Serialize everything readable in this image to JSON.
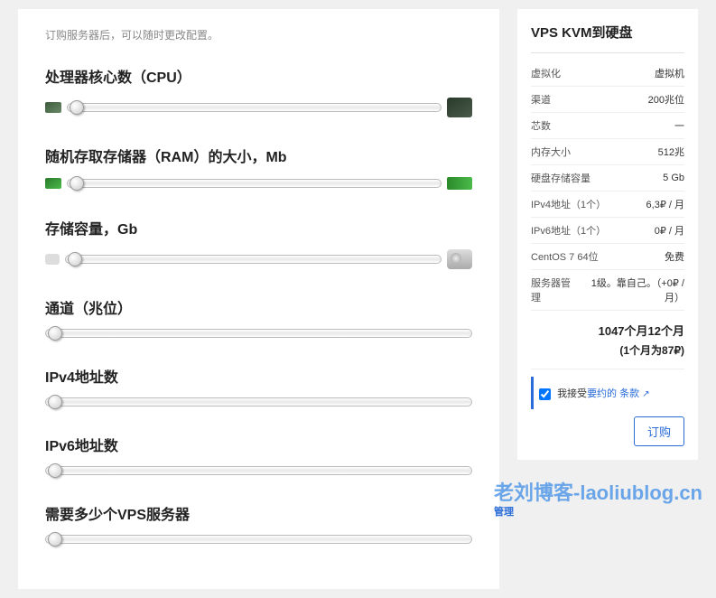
{
  "intro": "订购服务器后，可以随时更改配置。",
  "sliders": {
    "cpu": {
      "label": "处理器核心数（CPU）"
    },
    "ram": {
      "label": "随机存取存储器（RAM）的大小，Mb"
    },
    "storage": {
      "label": "存储容量，Gb"
    },
    "channel": {
      "label": "通道（兆位）"
    },
    "ipv4": {
      "label": "IPv4地址数"
    },
    "ipv6": {
      "label": "IPv6地址数"
    },
    "vpscount": {
      "label": "需要多少个VPS服务器"
    }
  },
  "summary": {
    "title": "VPS KVM到硬盘",
    "rows": [
      {
        "label": "虚拟化",
        "value": "虚拟机"
      },
      {
        "label": "渠道",
        "value": "200兆位"
      },
      {
        "label": "芯数",
        "value": "一"
      },
      {
        "label": "内存大小",
        "value": "512兆"
      },
      {
        "label": "硬盘存储容量",
        "value": "5 Gb"
      },
      {
        "label": "IPv4地址（1个）",
        "value": "6,3₽ / 月"
      },
      {
        "label": "IPv6地址（1个）",
        "value": "0₽ / 月"
      },
      {
        "label": "CentOS 7 64位",
        "value": "免费"
      },
      {
        "label": "服务器管理",
        "value": "1级。靠自己。（+0₽ / 月）"
      }
    ],
    "total_main": "1047个月12个月",
    "total_sub": "(1个月为87₽)",
    "terms_prefix": "我接受",
    "terms_mid": "要约的",
    "terms_link": "条款",
    "order_button": "订购"
  },
  "watermark": {
    "main": "老刘博客-laoliublog.cn",
    "sub": "管理"
  }
}
